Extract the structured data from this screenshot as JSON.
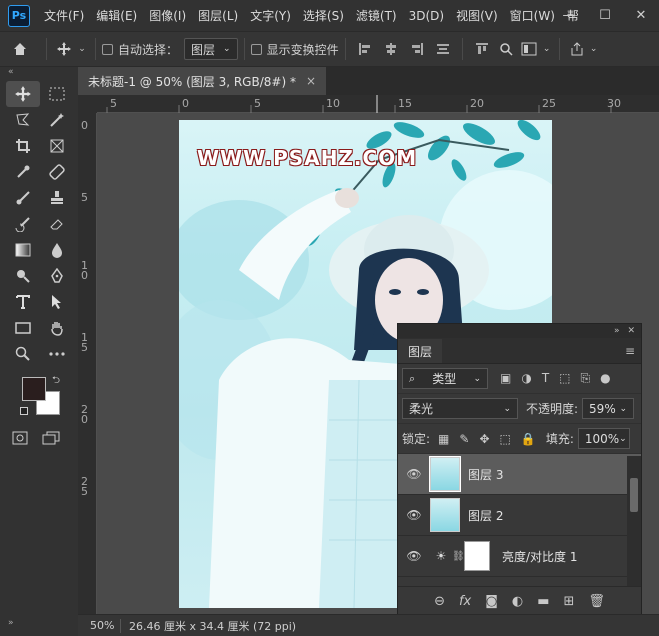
{
  "app": {
    "logo": "Ps"
  },
  "menu": [
    "文件(F)",
    "编辑(E)",
    "图像(I)",
    "图层(L)",
    "文字(Y)",
    "选择(S)",
    "滤镜(T)",
    "3D(D)",
    "视图(V)",
    "窗口(W)",
    "帮"
  ],
  "window_controls": {
    "minimize": "—",
    "maximize": "☐",
    "close": "✕"
  },
  "options_bar": {
    "auto_select_label": "自动选择：",
    "auto_select_target": "图层",
    "show_transform_label": "显示变换控件"
  },
  "document_tab": {
    "title": "未标题-1 @ 50% (图层 3, RGB/8#) *",
    "close": "×"
  },
  "ruler_h_labels": [
    "5",
    "0",
    "5",
    "10",
    "15",
    "20",
    "25",
    "30"
  ],
  "ruler_v_labels": [
    "0",
    "5",
    "1\n0",
    "1\n5",
    "2\n0",
    "2\n5"
  ],
  "canvas": {
    "watermark": "WWW.PSAHZ.COM"
  },
  "status": {
    "zoom": "50%",
    "doc_size": "26.46 厘米 x 34.4 厘米 (72 ppi)"
  },
  "colors": {
    "foreground": "#2a1e1e",
    "background": "#ffffff"
  },
  "layers_panel": {
    "tab": "图层",
    "filter_kind": "类型",
    "blend_mode": "柔光",
    "opacity_label": "不透明度:",
    "opacity_value": "59%",
    "lock_label": "锁定:",
    "fill_label": "填充:",
    "fill_value": "100%",
    "layers": [
      {
        "name": "图层 3",
        "selected": true
      },
      {
        "name": "图层 2",
        "selected": false
      },
      {
        "name": "亮度/对比度 1",
        "selected": false
      }
    ]
  }
}
